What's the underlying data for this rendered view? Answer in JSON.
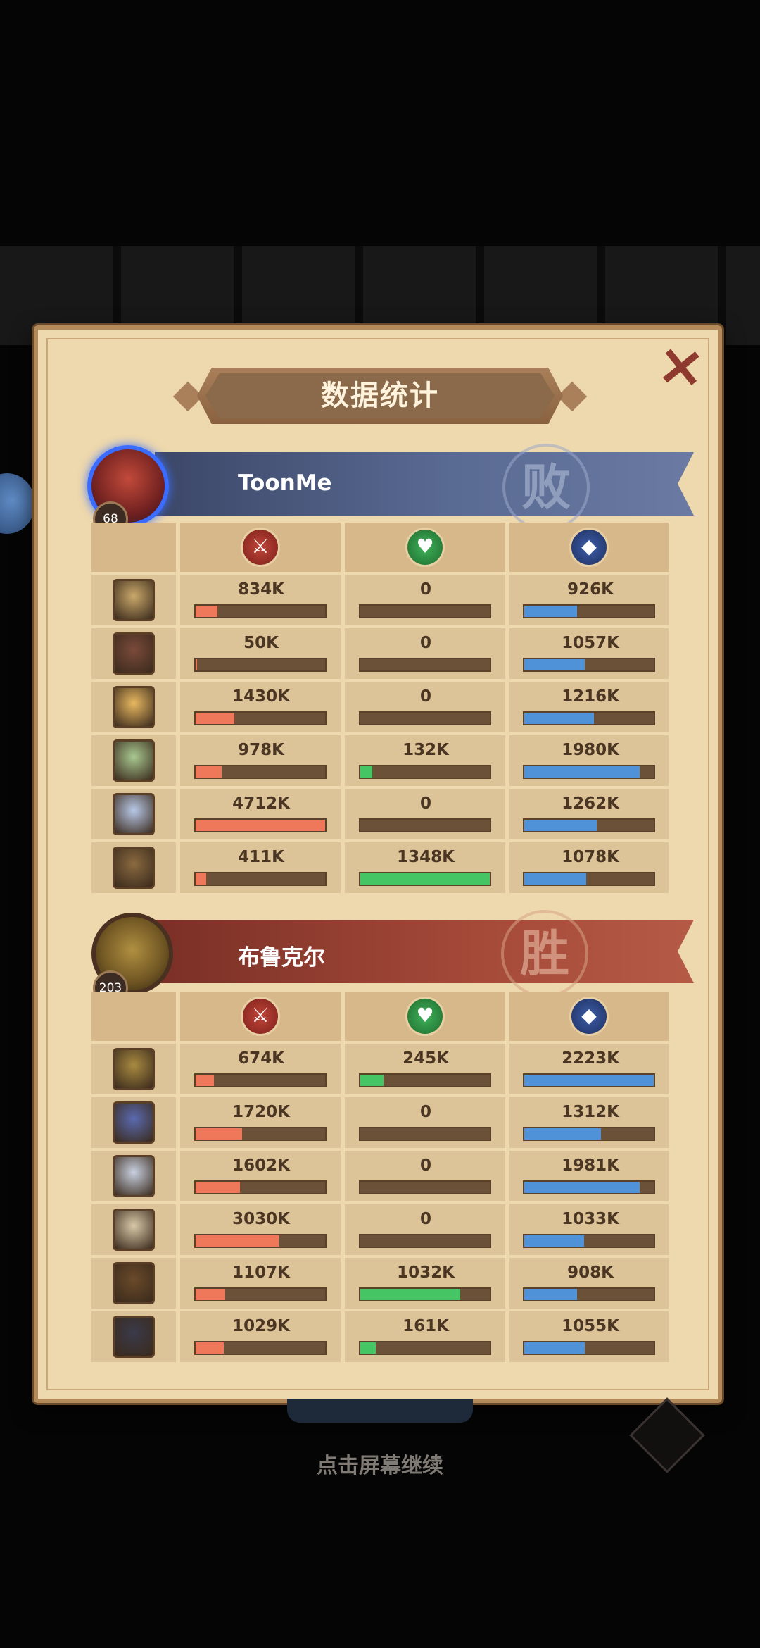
{
  "title": "数据统计",
  "hint": "点击屏幕继续",
  "close_icon": "×",
  "stat_icons": {
    "attack": "sword-icon",
    "heal": "heart-plus-icon",
    "defense": "shield-icon"
  },
  "colors": {
    "attack": "#f0785a",
    "heal": "#46c565",
    "defense": "#4f92d8",
    "panel": "#eed8ad"
  },
  "teams": [
    {
      "name": "ToonMe",
      "level": "68",
      "result": "败",
      "heroes": [
        {
          "portrait_color": "#c9a86a",
          "atk": "834K",
          "heal": "0",
          "def": "926K",
          "atk_fill": 0.17,
          "heal_fill": 0,
          "def_fill": 0.41
        },
        {
          "portrait_color": "#7a4a3a",
          "atk": "50K",
          "heal": "0",
          "def": "1057K",
          "atk_fill": 0.01,
          "heal_fill": 0,
          "def_fill": 0.47
        },
        {
          "portrait_color": "#e8b860",
          "atk": "1430K",
          "heal": "0",
          "def": "1216K",
          "atk_fill": 0.3,
          "heal_fill": 0,
          "def_fill": 0.54
        },
        {
          "portrait_color": "#a8c890",
          "atk": "978K",
          "heal": "132K",
          "def": "1980K",
          "atk_fill": 0.2,
          "heal_fill": 0.09,
          "def_fill": 0.89
        },
        {
          "portrait_color": "#b8c8e8",
          "atk": "4712K",
          "heal": "0",
          "def": "1262K",
          "atk_fill": 1.0,
          "heal_fill": 0,
          "def_fill": 0.56
        },
        {
          "portrait_color": "#8a6a40",
          "atk": "411K",
          "heal": "1348K",
          "def": "1078K",
          "atk_fill": 0.08,
          "heal_fill": 1.0,
          "def_fill": 0.48
        }
      ]
    },
    {
      "name": "布鲁克尔",
      "level": "203",
      "result": "胜",
      "heroes": [
        {
          "portrait_color": "#a88a40",
          "atk": "674K",
          "heal": "245K",
          "def": "2223K",
          "atk_fill": 0.14,
          "heal_fill": 0.18,
          "def_fill": 1.0
        },
        {
          "portrait_color": "#5a6ab0",
          "atk": "1720K",
          "heal": "0",
          "def": "1312K",
          "atk_fill": 0.36,
          "heal_fill": 0,
          "def_fill": 0.59
        },
        {
          "portrait_color": "#c8d0e0",
          "atk": "1602K",
          "heal": "0",
          "def": "1981K",
          "atk_fill": 0.34,
          "heal_fill": 0,
          "def_fill": 0.89
        },
        {
          "portrait_color": "#d8c8a8",
          "atk": "3030K",
          "heal": "0",
          "def": "1033K",
          "atk_fill": 0.64,
          "heal_fill": 0,
          "def_fill": 0.46
        },
        {
          "portrait_color": "#6a4a2a",
          "atk": "1107K",
          "heal": "1032K",
          "def": "908K",
          "atk_fill": 0.23,
          "heal_fill": 0.77,
          "def_fill": 0.41
        },
        {
          "portrait_color": "#3a3a4a",
          "atk": "1029K",
          "heal": "161K",
          "def": "1055K",
          "atk_fill": 0.22,
          "heal_fill": 0.12,
          "def_fill": 0.47
        }
      ]
    }
  ]
}
